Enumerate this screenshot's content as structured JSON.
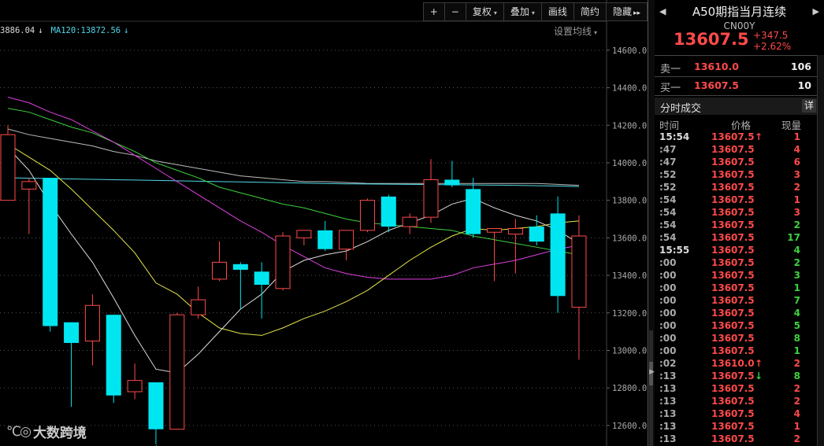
{
  "toolbar": {
    "buttons": [
      {
        "label": "+",
        "caret": false
      },
      {
        "label": "−",
        "caret": false
      },
      {
        "label": "复权",
        "caret": true
      },
      {
        "label": "叠加",
        "caret": true
      },
      {
        "label": "画线",
        "caret": false
      },
      {
        "label": "简约",
        "caret": false
      },
      {
        "label": "隐藏",
        "caret": false,
        "suffix": "▸▸"
      }
    ]
  },
  "ma_legend": [
    {
      "text": "3886.04",
      "arrow": "↓",
      "color": "#dddddd"
    },
    {
      "text": "MA120:13872.56",
      "arrow": "↓",
      "color": "#4fd8e8"
    }
  ],
  "settings_label": "设置均线",
  "colors": {
    "up": "#ff4a4a",
    "down": "#00e6f0",
    "ma_white": "#dddddd",
    "ma_yellow": "#e6e64a",
    "ma_magenta": "#e040e0",
    "ma_green": "#3cd23c",
    "ma_gray": "#bbbbbb",
    "ma_cyan": "#4fd8e8",
    "grid": "#555555",
    "axis_text": "#aaaaaa"
  },
  "chart_data": {
    "type": "candlestick",
    "yaxis_ticks": [
      "14600.0",
      "14400.0",
      "14200.0",
      "14000.0",
      "13800.0",
      "13600.0",
      "13400.0",
      "13200.0",
      "13000.0",
      "12800.0",
      "12600.0"
    ],
    "ylim": [
      12520,
      14700
    ],
    "low_marker": "12500.0",
    "candles": [
      {
        "o": 13800,
        "h": 14200,
        "l": 13800,
        "c": 14150
      },
      {
        "o": 13860,
        "h": 13920,
        "l": 13620,
        "c": 13900
      },
      {
        "o": 13920,
        "h": 13920,
        "l": 13100,
        "c": 13130
      },
      {
        "o": 13150,
        "h": 13140,
        "l": 12700,
        "c": 13040
      },
      {
        "o": 13050,
        "h": 13300,
        "l": 12920,
        "c": 13240
      },
      {
        "o": 13190,
        "h": 13190,
        "l": 12720,
        "c": 12760
      },
      {
        "o": 12780,
        "h": 12930,
        "l": 12740,
        "c": 12840
      },
      {
        "o": 12830,
        "h": 12830,
        "l": 12500,
        "c": 12580
      },
      {
        "o": 12580,
        "h": 13200,
        "l": 12580,
        "c": 13190
      },
      {
        "o": 13190,
        "h": 13340,
        "l": 13170,
        "c": 13270
      },
      {
        "o": 13380,
        "h": 13580,
        "l": 13370,
        "c": 13470
      },
      {
        "o": 13460,
        "h": 13470,
        "l": 13220,
        "c": 13430
      },
      {
        "o": 13420,
        "h": 13470,
        "l": 13170,
        "c": 13350
      },
      {
        "o": 13330,
        "h": 13630,
        "l": 13320,
        "c": 13610
      },
      {
        "o": 13600,
        "h": 13630,
        "l": 13560,
        "c": 13640
      },
      {
        "o": 13640,
        "h": 13690,
        "l": 13530,
        "c": 13540
      },
      {
        "o": 13540,
        "h": 13640,
        "l": 13480,
        "c": 13640
      },
      {
        "o": 13640,
        "h": 13810,
        "l": 13630,
        "c": 13800
      },
      {
        "o": 13820,
        "h": 13830,
        "l": 13630,
        "c": 13660
      },
      {
        "o": 13660,
        "h": 13730,
        "l": 13620,
        "c": 13710
      },
      {
        "o": 13710,
        "h": 14020,
        "l": 13680,
        "c": 13910
      },
      {
        "o": 13910,
        "h": 14010,
        "l": 13870,
        "c": 13880
      },
      {
        "o": 13860,
        "h": 13920,
        "l": 13600,
        "c": 13620
      },
      {
        "o": 13630,
        "h": 13640,
        "l": 13370,
        "c": 13650
      },
      {
        "o": 13620,
        "h": 13700,
        "l": 13410,
        "c": 13650
      },
      {
        "o": 13660,
        "h": 13720,
        "l": 13560,
        "c": 13580
      },
      {
        "o": 13730,
        "h": 13820,
        "l": 13200,
        "c": 13290
      },
      {
        "o": 13230,
        "h": 13720,
        "l": 12950,
        "c": 13610
      }
    ],
    "ma_white": [
      14080,
      13960,
      13780,
      13620,
      13470,
      13280,
      13080,
      12900,
      12880,
      12980,
      13100,
      13220,
      13300,
      13420,
      13480,
      13510,
      13530,
      13580,
      13640,
      13680,
      13720,
      13780,
      13810,
      13760,
      13720,
      13690,
      13640,
      13570
    ],
    "ma_yellow": [
      14100,
      14030,
      13960,
      13860,
      13750,
      13640,
      13520,
      13360,
      13300,
      13200,
      13120,
      13090,
      13080,
      13120,
      13170,
      13210,
      13260,
      13320,
      13400,
      13480,
      13550,
      13610,
      13650,
      13640,
      13650,
      13660,
      13680,
      13690
    ],
    "ma_magenta": [
      14350,
      14320,
      14270,
      14230,
      14170,
      14110,
      14040,
      13970,
      13900,
      13830,
      13760,
      13690,
      13630,
      13560,
      13500,
      13440,
      13410,
      13390,
      13380,
      13380,
      13380,
      13400,
      13440,
      13460,
      13480,
      13510,
      13540,
      13560
    ],
    "ma_green": [
      14290,
      14270,
      14230,
      14190,
      14160,
      14110,
      14060,
      14000,
      13960,
      13920,
      13870,
      13840,
      13810,
      13780,
      13760,
      13730,
      13700,
      13680,
      13670,
      13660,
      13650,
      13640,
      13610,
      13590,
      13570,
      13550,
      13530,
      13510
    ],
    "ma_gray": [
      14180,
      14150,
      14130,
      14110,
      14090,
      14060,
      14040,
      14010,
      13990,
      13970,
      13950,
      13930,
      13920,
      13910,
      13900,
      13900,
      13895,
      13890,
      13890,
      13890,
      13890,
      13890,
      13890,
      13890,
      13890,
      13890,
      13885,
      13880
    ],
    "ma_cyan": [
      13920,
      13918,
      13916,
      13914,
      13912,
      13910,
      13908,
      13906,
      13904,
      13902,
      13900,
      13898,
      13896,
      13894,
      13892,
      13890,
      13888,
      13887,
      13886,
      13885,
      13884,
      13883,
      13882,
      13881,
      13880,
      13878,
      13876,
      13873
    ]
  },
  "quote": {
    "title": "A50期指当月连续",
    "code": "CN00Y",
    "price": "13607.5",
    "change": "+347.5",
    "change_pct": "+2.62%",
    "ask_label": "卖一",
    "ask_price": "13610.0",
    "ask_vol": "106",
    "bid_label": "买一",
    "bid_price": "13607.5",
    "bid_vol": "10"
  },
  "trades_panel": {
    "title": "分时成交",
    "detail_btn": "详",
    "col_time": "时间",
    "col_price": "价格",
    "col_vol": "现量",
    "rows": [
      {
        "t": "15:54",
        "full": true,
        "p": "13607.5",
        "a": "↑",
        "ac": "#ff4a4a",
        "v": "1",
        "vc": "#ff4a4a"
      },
      {
        "t": ":47",
        "full": false,
        "p": "13607.5",
        "a": "",
        "ac": "",
        "v": "4",
        "vc": "#ff4a4a"
      },
      {
        "t": ":47",
        "full": false,
        "p": "13607.5",
        "a": "",
        "ac": "",
        "v": "6",
        "vc": "#ff4a4a"
      },
      {
        "t": ":52",
        "full": false,
        "p": "13607.5",
        "a": "",
        "ac": "",
        "v": "3",
        "vc": "#ff4a4a"
      },
      {
        "t": ":52",
        "full": false,
        "p": "13607.5",
        "a": "",
        "ac": "",
        "v": "2",
        "vc": "#ff4a4a"
      },
      {
        "t": ":54",
        "full": false,
        "p": "13607.5",
        "a": "",
        "ac": "",
        "v": "1",
        "vc": "#ff4a4a"
      },
      {
        "t": ":54",
        "full": false,
        "p": "13607.5",
        "a": "",
        "ac": "",
        "v": "3",
        "vc": "#ff4a4a"
      },
      {
        "t": ":54",
        "full": false,
        "p": "13607.5",
        "a": "",
        "ac": "",
        "v": "2",
        "vc": "#3cd23c"
      },
      {
        "t": ":54",
        "full": false,
        "p": "13607.5",
        "a": "",
        "ac": "",
        "v": "17",
        "vc": "#3cd23c"
      },
      {
        "t": "15:55",
        "full": true,
        "p": "13607.5",
        "a": "",
        "ac": "",
        "v": "4",
        "vc": "#3cd23c"
      },
      {
        "t": ":00",
        "full": false,
        "p": "13607.5",
        "a": "",
        "ac": "",
        "v": "2",
        "vc": "#3cd23c"
      },
      {
        "t": ":00",
        "full": false,
        "p": "13607.5",
        "a": "",
        "ac": "",
        "v": "3",
        "vc": "#3cd23c"
      },
      {
        "t": ":00",
        "full": false,
        "p": "13607.5",
        "a": "",
        "ac": "",
        "v": "1",
        "vc": "#3cd23c"
      },
      {
        "t": ":00",
        "full": false,
        "p": "13607.5",
        "a": "",
        "ac": "",
        "v": "7",
        "vc": "#3cd23c"
      },
      {
        "t": ":00",
        "full": false,
        "p": "13607.5",
        "a": "",
        "ac": "",
        "v": "4",
        "vc": "#3cd23c"
      },
      {
        "t": ":00",
        "full": false,
        "p": "13607.5",
        "a": "",
        "ac": "",
        "v": "5",
        "vc": "#3cd23c"
      },
      {
        "t": ":00",
        "full": false,
        "p": "13607.5",
        "a": "",
        "ac": "",
        "v": "8",
        "vc": "#3cd23c"
      },
      {
        "t": ":00",
        "full": false,
        "p": "13607.5",
        "a": "",
        "ac": "",
        "v": "1",
        "vc": "#3cd23c"
      },
      {
        "t": ":02",
        "full": false,
        "p": "13610.0",
        "a": "↑",
        "ac": "#ff4a4a",
        "v": "2",
        "vc": "#ff4a4a"
      },
      {
        "t": ":13",
        "full": false,
        "p": "13607.5",
        "a": "↓",
        "ac": "#3cd23c",
        "v": "8",
        "vc": "#3cd23c"
      },
      {
        "t": ":13",
        "full": false,
        "p": "13607.5",
        "a": "",
        "ac": "",
        "v": "2",
        "vc": "#ff4a4a"
      },
      {
        "t": ":13",
        "full": false,
        "p": "13607.5",
        "a": "",
        "ac": "",
        "v": "2",
        "vc": "#ff4a4a"
      },
      {
        "t": ":13",
        "full": false,
        "p": "13607.5",
        "a": "",
        "ac": "",
        "v": "4",
        "vc": "#ff4a4a"
      },
      {
        "t": ":13",
        "full": false,
        "p": "13607.5",
        "a": "",
        "ac": "",
        "v": "1",
        "vc": "#ff4a4a"
      },
      {
        "t": ":13",
        "full": false,
        "p": "13607.5",
        "a": "",
        "ac": "",
        "v": "2",
        "vc": "#ff4a4a"
      }
    ]
  },
  "watermark": {
    "logo": "℃◎",
    "text": "大数跨境"
  }
}
